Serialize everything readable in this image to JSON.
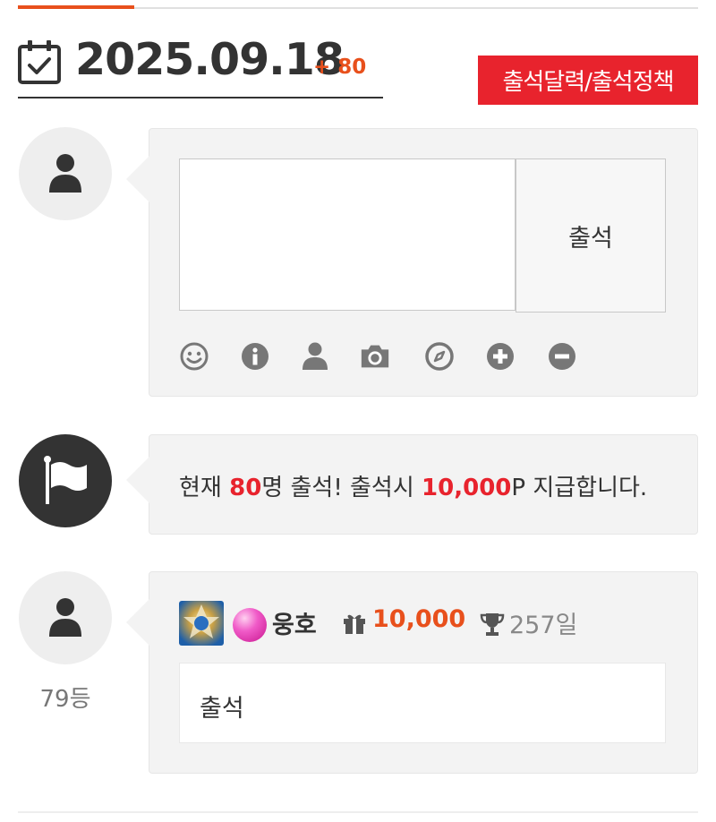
{
  "header": {
    "date": "2025.09.18",
    "count_plus": "+ 80",
    "policy_button": "출석달력/출석정책"
  },
  "compose": {
    "textarea_placeholder": "",
    "submit_label": "출석",
    "tools": [
      "smiley-icon",
      "info-icon",
      "user-icon",
      "camera-icon",
      "compass-icon",
      "plus-circle-icon",
      "minus-circle-icon"
    ]
  },
  "notice": {
    "prefix": "현재 ",
    "count": "80",
    "middle": "명 출석! 출석시 ",
    "points": "10,000",
    "suffix": "P 지급합니다."
  },
  "entry": {
    "rank": "79등",
    "name": "웅호",
    "points": "10,000",
    "days": "257일",
    "comment": "출석"
  },
  "colors": {
    "accent_orange": "#e8501c",
    "accent_red": "#e8232d",
    "bubble_bg": "#f3f3f3"
  }
}
